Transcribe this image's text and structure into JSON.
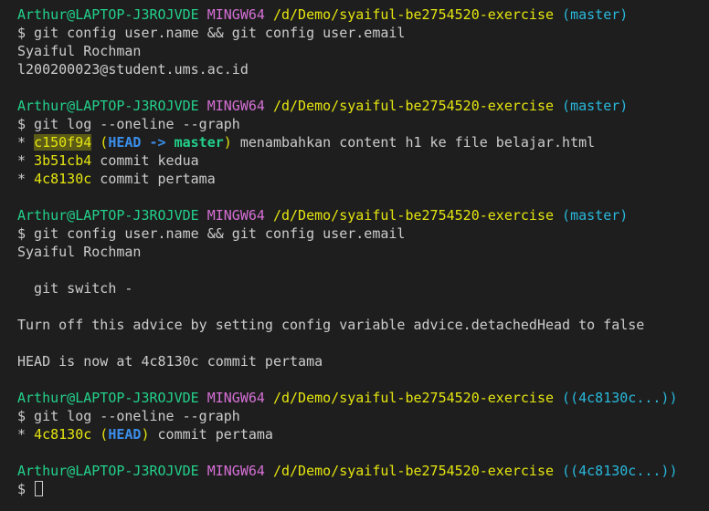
{
  "colors": {
    "background": "#1e1e1e",
    "text": "#cccccc",
    "user_host": "#23d18b",
    "msystem": "#d670d6",
    "path": "#e5e510",
    "branch": "#29b8db",
    "head": "#3b8eea",
    "master": "#23d18b"
  },
  "lines": [
    [
      {
        "t": "Arthur@LAPTOP-J3ROJVDE",
        "c": "user"
      },
      {
        "t": " ",
        "c": "text"
      },
      {
        "t": "MINGW64",
        "c": "msys"
      },
      {
        "t": " ",
        "c": "text"
      },
      {
        "t": "/d/Demo/syaiful-be2754520-exercise",
        "c": "path"
      },
      {
        "t": " ",
        "c": "text"
      },
      {
        "t": "(master)",
        "c": "branch"
      }
    ],
    [
      {
        "t": "$ git config user.name && git config user.email",
        "c": "text"
      }
    ],
    [
      {
        "t": "Syaiful Rochman",
        "c": "text"
      }
    ],
    [
      {
        "t": "l200200023@student.ums.ac.id",
        "c": "text"
      }
    ],
    [],
    [
      {
        "t": "Arthur@LAPTOP-J3ROJVDE",
        "c": "user"
      },
      {
        "t": " ",
        "c": "text"
      },
      {
        "t": "MINGW64",
        "c": "msys"
      },
      {
        "t": " ",
        "c": "text"
      },
      {
        "t": "/d/Demo/syaiful-be2754520-exercise",
        "c": "path"
      },
      {
        "t": " ",
        "c": "text"
      },
      {
        "t": "(master)",
        "c": "branch"
      }
    ],
    [
      {
        "t": "$ git log --oneline --graph",
        "c": "text"
      }
    ],
    [
      {
        "t": "* ",
        "c": "text"
      },
      {
        "t": "c150f94",
        "c": "hash",
        "hl": true
      },
      {
        "t": " (",
        "c": "hash"
      },
      {
        "t": "HEAD -> ",
        "c": "head"
      },
      {
        "t": "master",
        "c": "master"
      },
      {
        "t": ")",
        "c": "hash"
      },
      {
        "t": " menambahkan content h1 ke file belajar.html",
        "c": "text"
      }
    ],
    [
      {
        "t": "* ",
        "c": "text"
      },
      {
        "t": "3b51cb4",
        "c": "hash"
      },
      {
        "t": " commit kedua",
        "c": "text"
      }
    ],
    [
      {
        "t": "* ",
        "c": "text"
      },
      {
        "t": "4c8130c",
        "c": "hash"
      },
      {
        "t": " commit pertama",
        "c": "text"
      }
    ],
    [],
    [
      {
        "t": "Arthur@LAPTOP-J3ROJVDE",
        "c": "user"
      },
      {
        "t": " ",
        "c": "text"
      },
      {
        "t": "MINGW64",
        "c": "msys"
      },
      {
        "t": " ",
        "c": "text"
      },
      {
        "t": "/d/Demo/syaiful-be2754520-exercise",
        "c": "path"
      },
      {
        "t": " ",
        "c": "text"
      },
      {
        "t": "(master)",
        "c": "branch"
      }
    ],
    [
      {
        "t": "$ git config user.name && git config user.email",
        "c": "text"
      }
    ],
    [
      {
        "t": "Syaiful Rochman",
        "c": "text"
      }
    ],
    [],
    [
      {
        "t": "  git switch -",
        "c": "text"
      }
    ],
    [],
    [
      {
        "t": "Turn off this advice by setting config variable advice.detachedHead to false",
        "c": "text"
      }
    ],
    [],
    [
      {
        "t": "HEAD is now at 4c8130c commit pertama",
        "c": "text"
      }
    ],
    [],
    [
      {
        "t": "Arthur@LAPTOP-J3ROJVDE",
        "c": "user"
      },
      {
        "t": " ",
        "c": "text"
      },
      {
        "t": "MINGW64",
        "c": "msys"
      },
      {
        "t": " ",
        "c": "text"
      },
      {
        "t": "/d/Demo/syaiful-be2754520-exercise",
        "c": "path"
      },
      {
        "t": " ",
        "c": "text"
      },
      {
        "t": "((4c8130c...))",
        "c": "branch"
      }
    ],
    [
      {
        "t": "$ git log --oneline --graph",
        "c": "text"
      }
    ],
    [
      {
        "t": "* ",
        "c": "text"
      },
      {
        "t": "4c8130c",
        "c": "hash"
      },
      {
        "t": " (",
        "c": "hash"
      },
      {
        "t": "HEAD",
        "c": "head"
      },
      {
        "t": ")",
        "c": "hash"
      },
      {
        "t": " commit pertama",
        "c": "text"
      }
    ],
    [],
    [
      {
        "t": "Arthur@LAPTOP-J3ROJVDE",
        "c": "user"
      },
      {
        "t": " ",
        "c": "text"
      },
      {
        "t": "MINGW64",
        "c": "msys"
      },
      {
        "t": " ",
        "c": "text"
      },
      {
        "t": "/d/Demo/syaiful-be2754520-exercise",
        "c": "path"
      },
      {
        "t": " ",
        "c": "text"
      },
      {
        "t": "((4c8130c...))",
        "c": "branch"
      }
    ],
    [
      {
        "t": "$ ",
        "c": "text"
      },
      {
        "t": "",
        "c": "cursor"
      }
    ]
  ]
}
